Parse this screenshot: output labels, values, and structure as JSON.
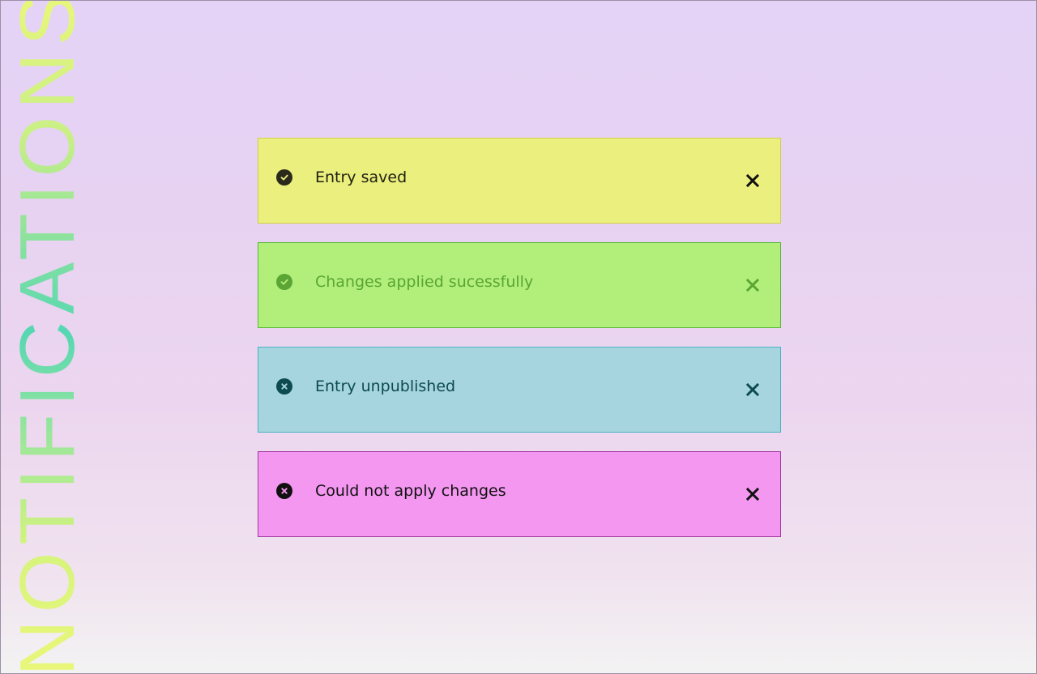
{
  "title": "NOTIFICATIONS",
  "notifications": [
    {
      "message": "Entry saved",
      "status": "success",
      "icon": "check-circle-icon",
      "bg": "#ebef7d",
      "fg": "#1f1f12",
      "icon_color": "#2a2a1c"
    },
    {
      "message": "Changes applied sucessfully",
      "status": "success",
      "icon": "check-circle-icon",
      "bg": "#b1ef7a",
      "fg": "#5aa534",
      "icon_color": "#5aa534"
    },
    {
      "message": "Entry unpublished",
      "status": "error",
      "icon": "x-circle-icon",
      "bg": "#a6d4df",
      "fg": "#0d4b4f",
      "icon_color": "#0d4b4f"
    },
    {
      "message": "Could not apply changes",
      "status": "error",
      "icon": "x-circle-icon",
      "bg": "#f497f0",
      "fg": "#111111",
      "icon_color": "#111111"
    }
  ]
}
